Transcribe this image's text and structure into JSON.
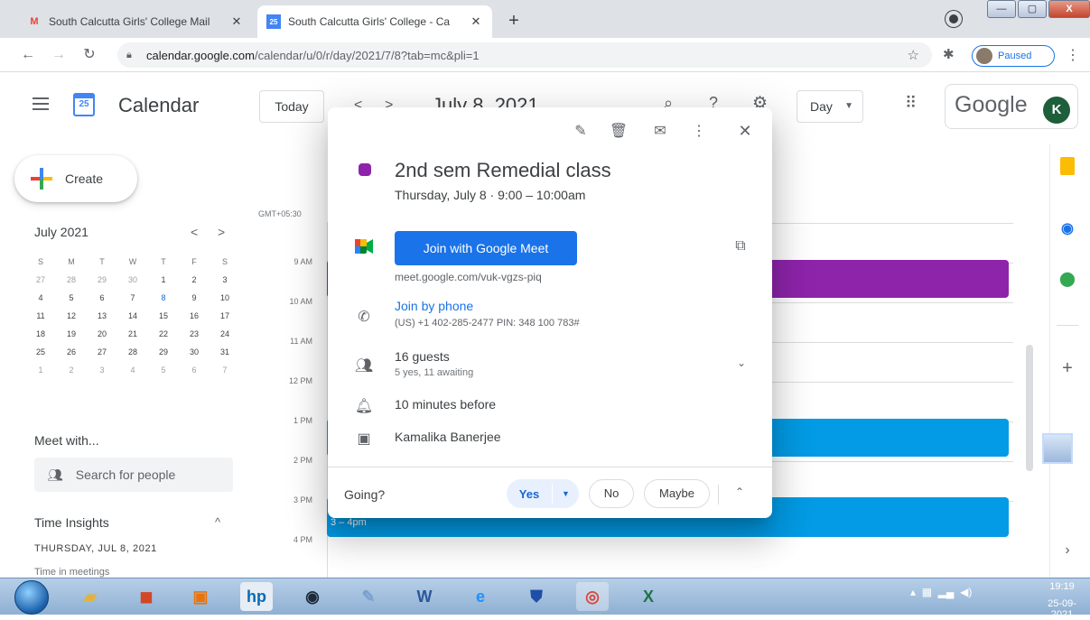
{
  "browser": {
    "tabs": [
      {
        "title": "South Calcutta Girls' College Mail",
        "favicon": "gmail-icon"
      },
      {
        "title": "South Calcutta Girls' College - Ca",
        "favicon": "calendar-icon"
      }
    ],
    "url_host": "calendar.google.com",
    "url_path": "/calendar/u/0/r/day/2021/7/8?tab=mc&pli=1",
    "profile_status": "Paused"
  },
  "header": {
    "app_name": "Calendar",
    "logo_day": "25",
    "today_label": "Today",
    "date_title": "July 8, 2021",
    "view_label": "Day",
    "google_word": "Google",
    "avatar_initial": "K"
  },
  "sidebar": {
    "create_label": "Create",
    "mini_cal": {
      "month": "July 2021",
      "weekdays": [
        "S",
        "M",
        "T",
        "W",
        "T",
        "F",
        "S"
      ],
      "weeks": [
        [
          "27",
          "28",
          "29",
          "30",
          "1",
          "2",
          "3"
        ],
        [
          "4",
          "5",
          "6",
          "7",
          "8",
          "9",
          "10"
        ],
        [
          "11",
          "12",
          "13",
          "14",
          "15",
          "16",
          "17"
        ],
        [
          "18",
          "19",
          "20",
          "21",
          "22",
          "23",
          "24"
        ],
        [
          "25",
          "26",
          "27",
          "28",
          "29",
          "30",
          "31"
        ],
        [
          "1",
          "2",
          "3",
          "4",
          "5",
          "6",
          "7"
        ]
      ],
      "selected": "8"
    },
    "meet_with": "Meet with...",
    "search_people_placeholder": "Search for people",
    "time_insights": "Time Insights",
    "insights_date": "THURSDAY, JUL 8, 2021",
    "insights_meetings": "Time in meetings"
  },
  "day_view": {
    "timezone": "GMT+05:30",
    "hours": [
      "9 AM",
      "10 AM",
      "11 AM",
      "12 PM",
      "1 PM",
      "2 PM",
      "3 PM",
      "4 PM"
    ],
    "event3_label": "3 – 4pm",
    "event_colors": {
      "purple": "#8e24aa",
      "blue": "#039be5"
    }
  },
  "popup": {
    "title": "2nd sem Remedial class",
    "when": "Thursday, July 8  ·  9:00 – 10:00am",
    "meet_button": "Join with Google Meet",
    "meet_url": "meet.google.com/vuk-vgzs-piq",
    "phone_link": "Join by phone",
    "phone_number": "(US) +1 402-285-2477 PIN: 348 100 783#",
    "guests": "16 guests",
    "guests_sub": "5 yes, 11 awaiting",
    "reminder": "10 minutes before",
    "organizer": "Kamalika Banerjee",
    "going_label": "Going?",
    "rsvp_yes": "Yes",
    "rsvp_no": "No",
    "rsvp_maybe": "Maybe",
    "color": "#8e24aa"
  },
  "taskbar": {
    "time": "19:19",
    "date": "25-09-2021"
  }
}
